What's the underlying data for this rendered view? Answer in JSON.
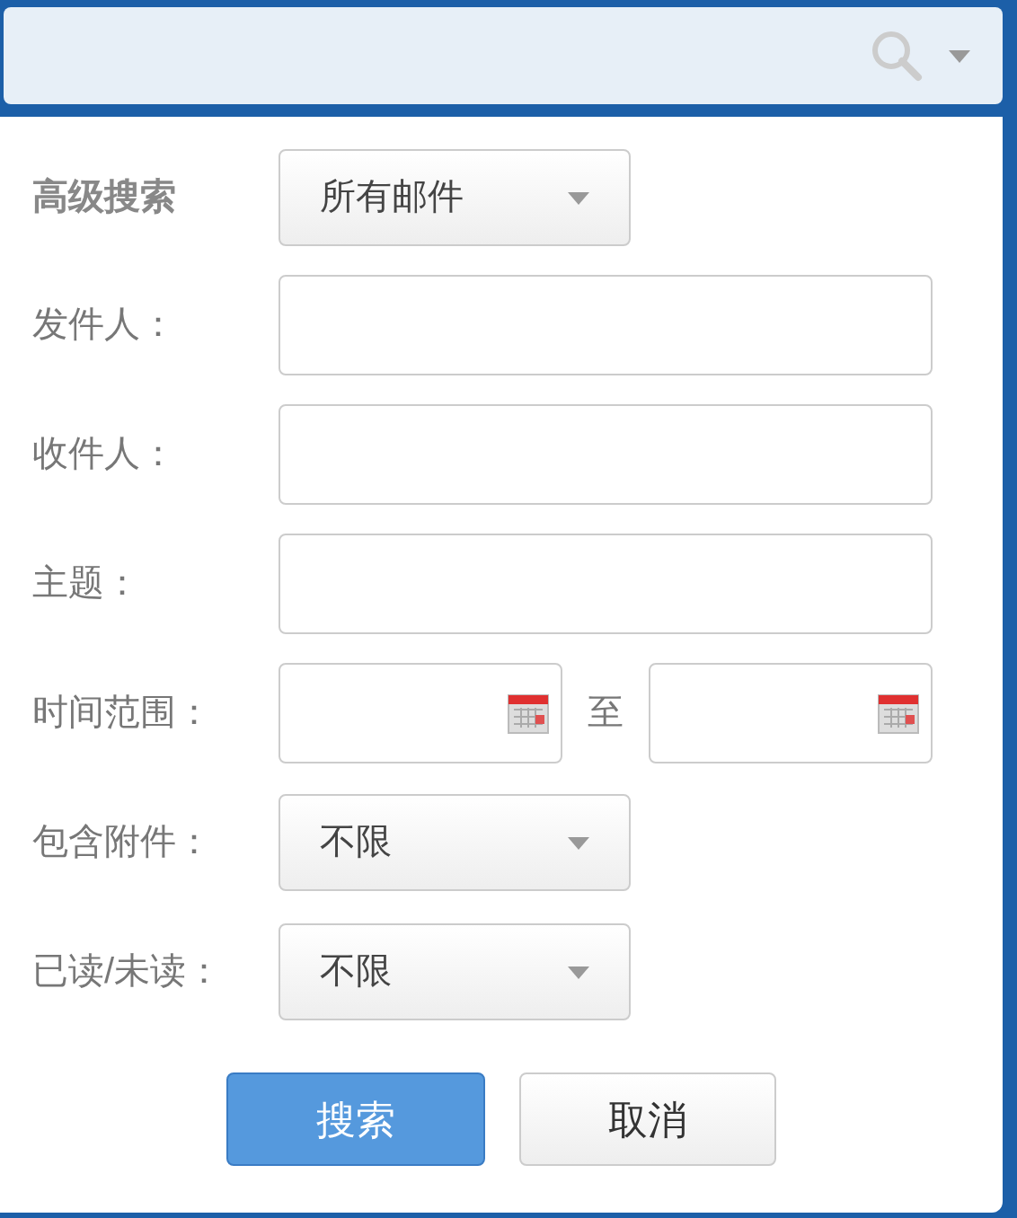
{
  "panel": {
    "title": "高级搜索",
    "scope": "所有邮件",
    "fields": [
      {
        "kind": "text",
        "label": "发件人："
      },
      {
        "kind": "text",
        "label": "收件人："
      },
      {
        "kind": "text",
        "label": "主题："
      },
      {
        "kind": "daterange",
        "label": "时间范围：",
        "separator": "至"
      },
      {
        "kind": "select",
        "label": "包含附件：",
        "value": "不限"
      },
      {
        "kind": "select",
        "label": "已读/未读：",
        "value": "不限"
      }
    ],
    "buttons": [
      {
        "kind": "primary",
        "label": "搜索"
      },
      {
        "kind": "secondary",
        "label": "取消"
      }
    ]
  }
}
